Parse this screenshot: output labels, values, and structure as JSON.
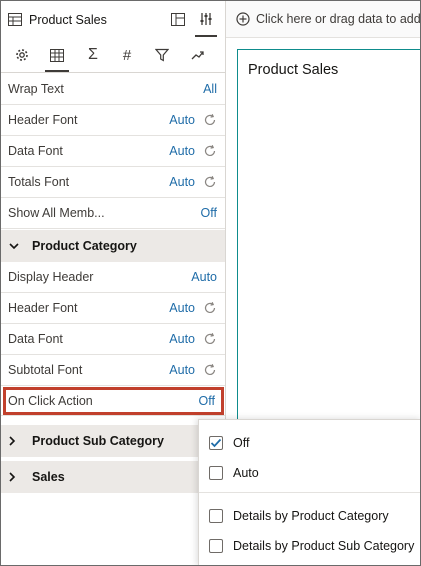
{
  "panel": {
    "title": "Product Sales",
    "tabs": [
      "gear-icon",
      "table-icon",
      "sigma-icon",
      "hash-icon",
      "filter-icon",
      "trend-icon"
    ],
    "rows_top": [
      {
        "label": "Wrap Text",
        "value": "All",
        "reset": false
      },
      {
        "label": "Header Font",
        "value": "Auto",
        "reset": true
      },
      {
        "label": "Data Font",
        "value": "Auto",
        "reset": true
      },
      {
        "label": "Totals Font",
        "value": "Auto",
        "reset": true
      },
      {
        "label": "Show All Memb...",
        "value": "Off",
        "reset": false
      }
    ],
    "section_category": "Product Category",
    "rows_category": [
      {
        "label": "Display Header",
        "value": "Auto",
        "reset": false
      },
      {
        "label": "Header Font",
        "value": "Auto",
        "reset": true
      },
      {
        "label": "Data Font",
        "value": "Auto",
        "reset": true
      },
      {
        "label": "Subtotal Font",
        "value": "Auto",
        "reset": true
      },
      {
        "label": "On Click Action",
        "value": "Off",
        "reset": false
      }
    ],
    "section_sub_category": "Product Sub Category",
    "section_sales": "Sales"
  },
  "toolbar": {
    "hint": "Click here or drag data to add"
  },
  "canvas": {
    "title": "Product Sales"
  },
  "dropdown": {
    "options": [
      {
        "label": "Off",
        "checked": true
      },
      {
        "label": "Auto",
        "checked": false
      },
      {
        "label": "Details by Product Category",
        "checked": false
      },
      {
        "label": "Details by Product Sub Category",
        "checked": false
      }
    ]
  },
  "colors": {
    "accent": "#1f6ca8",
    "highlight": "#c1402c",
    "card_border": "#0e8c8c"
  }
}
